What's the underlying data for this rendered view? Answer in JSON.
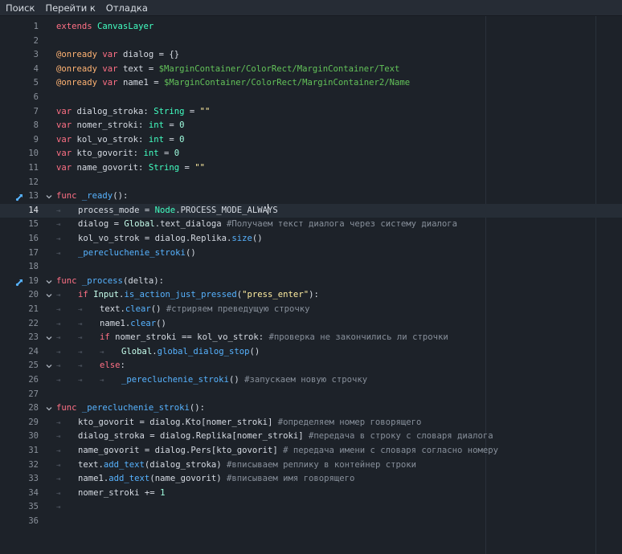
{
  "menu": {
    "items": [
      "Поиск",
      "Перейти к",
      "Отладка"
    ]
  },
  "colors": {
    "background": "#1d2229",
    "keyword": "#ff7085",
    "annotation": "#ffb373",
    "string": "#ffeda1",
    "node_path": "#63c259",
    "type": "#42ffc2",
    "number": "#a1ffe0",
    "comment": "#88909b",
    "function": "#57b3ff"
  },
  "editor": {
    "current_line": 14,
    "lines": [
      {
        "n": "1",
        "t": [
          [
            "k",
            "extends"
          ],
          [
            "p",
            " "
          ],
          [
            "ty",
            "CanvasLayer"
          ]
        ]
      },
      {
        "n": "2",
        "t": []
      },
      {
        "n": "3",
        "t": [
          [
            "ann",
            "@onready"
          ],
          [
            "p",
            " "
          ],
          [
            "k",
            "var"
          ],
          [
            "p",
            " dialog = {}"
          ]
        ]
      },
      {
        "n": "4",
        "t": [
          [
            "ann",
            "@onready"
          ],
          [
            "p",
            " "
          ],
          [
            "k",
            "var"
          ],
          [
            "p",
            " text = "
          ],
          [
            "np",
            "$MarginContainer/ColorRect/MarginContainer/Text"
          ]
        ]
      },
      {
        "n": "5",
        "t": [
          [
            "ann",
            "@onready"
          ],
          [
            "p",
            " "
          ],
          [
            "k",
            "var"
          ],
          [
            "p",
            " name1 = "
          ],
          [
            "np",
            "$MarginContainer/ColorRect/MarginContainer2/Name"
          ]
        ]
      },
      {
        "n": "6",
        "t": []
      },
      {
        "n": "7",
        "t": [
          [
            "k",
            "var"
          ],
          [
            "p",
            " dialog_stroka: "
          ],
          [
            "ty",
            "String"
          ],
          [
            "p",
            " = "
          ],
          [
            "str",
            "\"\""
          ]
        ]
      },
      {
        "n": "8",
        "t": [
          [
            "k",
            "var"
          ],
          [
            "p",
            " nomer_stroki: "
          ],
          [
            "ty",
            "int"
          ],
          [
            "p",
            " = "
          ],
          [
            "num",
            "0"
          ]
        ]
      },
      {
        "n": "9",
        "t": [
          [
            "k",
            "var"
          ],
          [
            "p",
            " kol_vo_strok: "
          ],
          [
            "ty",
            "int"
          ],
          [
            "p",
            " = "
          ],
          [
            "num",
            "0"
          ]
        ]
      },
      {
        "n": "10",
        "t": [
          [
            "k",
            "var"
          ],
          [
            "p",
            " kto_govorit: "
          ],
          [
            "ty",
            "int"
          ],
          [
            "p",
            " = "
          ],
          [
            "num",
            "0"
          ]
        ]
      },
      {
        "n": "11",
        "t": [
          [
            "k",
            "var"
          ],
          [
            "p",
            " name_govorit: "
          ],
          [
            "ty",
            "String"
          ],
          [
            "p",
            " = "
          ],
          [
            "str",
            "\"\""
          ]
        ]
      },
      {
        "n": "12",
        "t": []
      },
      {
        "n": "13",
        "icon": "override",
        "fold": true,
        "t": [
          [
            "k",
            "func"
          ],
          [
            "p",
            " "
          ],
          [
            "fn",
            "_ready"
          ],
          [
            "p",
            "():"
          ]
        ]
      },
      {
        "n": "14",
        "tabs": 1,
        "t": [
          [
            "p",
            "process_mode = "
          ],
          [
            "ty",
            "Node"
          ],
          [
            "p",
            ".PROCESS_MODE_ALWA"
          ],
          [
            "cursor",
            ""
          ],
          [
            "p",
            "YS"
          ]
        ]
      },
      {
        "n": "15",
        "tabs": 1,
        "t": [
          [
            "p",
            "dialog = "
          ],
          [
            "cl",
            "Global"
          ],
          [
            "p",
            ".text_dialoga "
          ],
          [
            "cm",
            "#Получаем текст диалога через систему диалога"
          ]
        ]
      },
      {
        "n": "16",
        "tabs": 1,
        "t": [
          [
            "p",
            "kol_vo_strok = dialog.Replika."
          ],
          [
            "fn",
            "size"
          ],
          [
            "p",
            "()"
          ]
        ]
      },
      {
        "n": "17",
        "tabs": 1,
        "t": [
          [
            "fn",
            "_perecluchenie_stroki"
          ],
          [
            "p",
            "()"
          ]
        ]
      },
      {
        "n": "18",
        "t": []
      },
      {
        "n": "19",
        "icon": "override",
        "fold": true,
        "t": [
          [
            "k",
            "func"
          ],
          [
            "p",
            " "
          ],
          [
            "fn",
            "_process"
          ],
          [
            "p",
            "(delta):"
          ]
        ]
      },
      {
        "n": "20",
        "fold": true,
        "tabs": 1,
        "t": [
          [
            "k",
            "if"
          ],
          [
            "p",
            " "
          ],
          [
            "cl",
            "Input"
          ],
          [
            "p",
            "."
          ],
          [
            "fn",
            "is_action_just_pressed"
          ],
          [
            "p",
            "("
          ],
          [
            "str",
            "\"press_enter\""
          ],
          [
            "p",
            "):"
          ]
        ]
      },
      {
        "n": "21",
        "tabs": 2,
        "t": [
          [
            "p",
            "text."
          ],
          [
            "fn",
            "clear"
          ],
          [
            "p",
            "() "
          ],
          [
            "cm",
            "#стриряем преведущую строчку"
          ]
        ]
      },
      {
        "n": "22",
        "tabs": 2,
        "t": [
          [
            "p",
            "name1."
          ],
          [
            "fn",
            "clear"
          ],
          [
            "p",
            "()"
          ]
        ]
      },
      {
        "n": "23",
        "fold": true,
        "tabs": 2,
        "t": [
          [
            "k",
            "if"
          ],
          [
            "p",
            " nomer_stroki == kol_vo_strok: "
          ],
          [
            "cm",
            "#проверка не закончились ли строчки"
          ]
        ]
      },
      {
        "n": "24",
        "tabs": 3,
        "t": [
          [
            "cl",
            "Global"
          ],
          [
            "p",
            "."
          ],
          [
            "fn",
            "global_dialog_stop"
          ],
          [
            "p",
            "()"
          ]
        ]
      },
      {
        "n": "25",
        "fold": true,
        "tabs": 2,
        "t": [
          [
            "k",
            "else"
          ],
          [
            "p",
            ":"
          ]
        ]
      },
      {
        "n": "26",
        "tabs": 3,
        "t": [
          [
            "fn",
            "_perecluchenie_stroki"
          ],
          [
            "p",
            "() "
          ],
          [
            "cm",
            "#запускаем новую строчку"
          ]
        ]
      },
      {
        "n": "27",
        "t": []
      },
      {
        "n": "28",
        "fold": true,
        "t": [
          [
            "k",
            "func"
          ],
          [
            "p",
            " "
          ],
          [
            "fn",
            "_perecluchenie_stroki"
          ],
          [
            "p",
            "():"
          ]
        ]
      },
      {
        "n": "29",
        "tabs": 1,
        "t": [
          [
            "p",
            "kto_govorit = dialog.Kto[nomer_stroki] "
          ],
          [
            "cm",
            "#определяем номер говорящего"
          ]
        ]
      },
      {
        "n": "30",
        "tabs": 1,
        "t": [
          [
            "p",
            "dialog_stroka = dialog.Replika[nomer_stroki] "
          ],
          [
            "cm",
            "#передача в строку с словаря диалога"
          ]
        ]
      },
      {
        "n": "31",
        "tabs": 1,
        "t": [
          [
            "p",
            "name_govorit = dialog.Pers[kto_govorit] "
          ],
          [
            "cm",
            "# передача имени с словаря согласно номеру"
          ]
        ]
      },
      {
        "n": "32",
        "tabs": 1,
        "t": [
          [
            "p",
            "text."
          ],
          [
            "fn",
            "add_text"
          ],
          [
            "p",
            "(dialog_stroka) "
          ],
          [
            "cm",
            "#вписываем реплику в контейнер строки"
          ]
        ]
      },
      {
        "n": "33",
        "tabs": 1,
        "t": [
          [
            "p",
            "name1."
          ],
          [
            "fn",
            "add_text"
          ],
          [
            "p",
            "(name_govorit) "
          ],
          [
            "cm",
            "#вписываем имя говорящего"
          ]
        ]
      },
      {
        "n": "34",
        "tabs": 1,
        "t": [
          [
            "p",
            "nomer_stroki += "
          ],
          [
            "num",
            "1"
          ]
        ]
      },
      {
        "n": "35",
        "tabs": 1,
        "t": []
      },
      {
        "n": "36",
        "t": []
      }
    ]
  }
}
